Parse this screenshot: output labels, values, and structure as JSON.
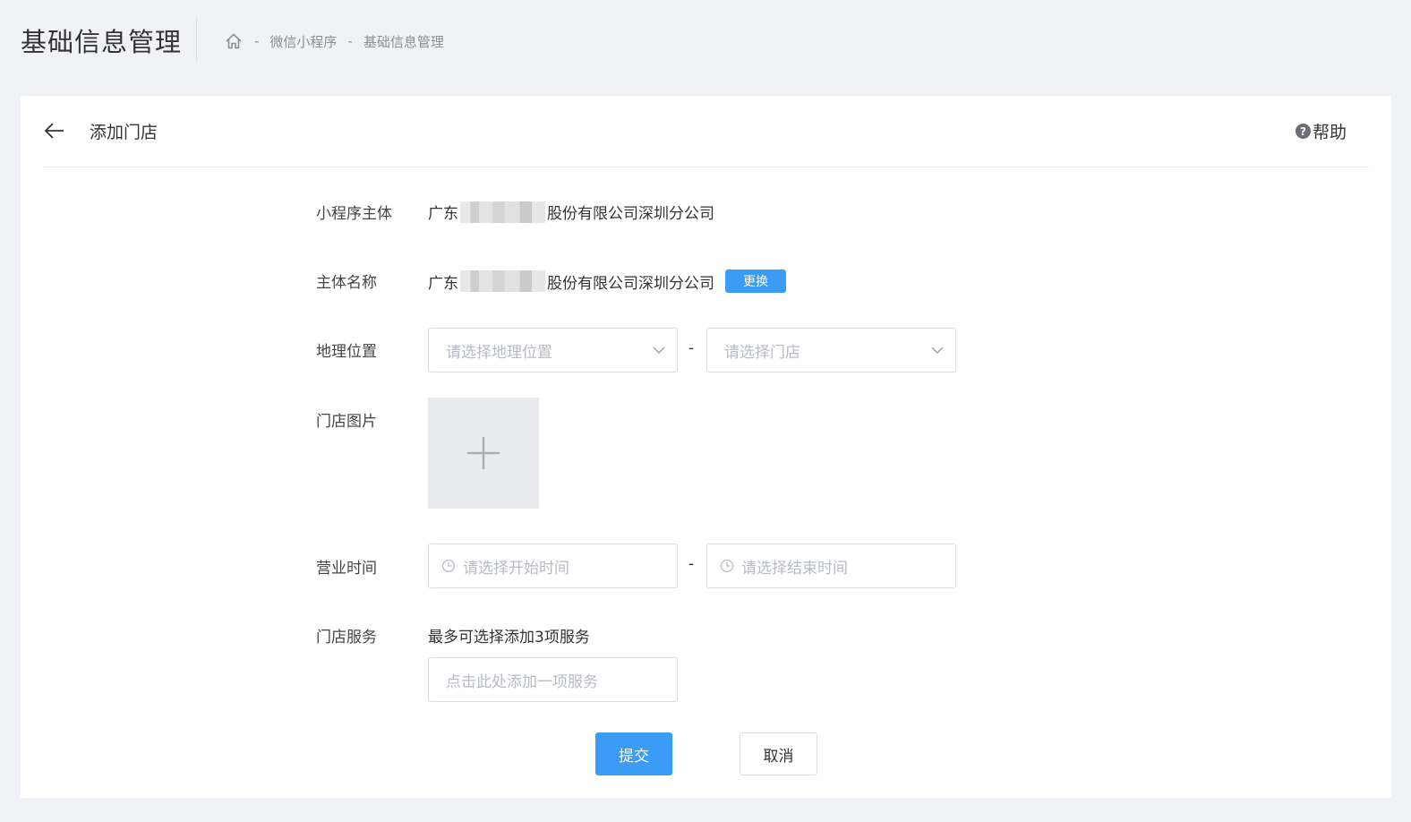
{
  "header": {
    "title": "基础信息管理",
    "breadcrumb": [
      "微信小程序",
      "基础信息管理"
    ],
    "separator": "-"
  },
  "card": {
    "title": "添加门店",
    "help_label": "帮助",
    "help_glyph": "?"
  },
  "form": {
    "subject": {
      "label": "小程序主体",
      "value_prefix": "广东",
      "value_suffix": "股份有限公司深圳分公司"
    },
    "entity_name": {
      "label": "主体名称",
      "value_prefix": "广东",
      "value_suffix": "股份有限公司深圳分公司",
      "change_button": "更换"
    },
    "location": {
      "label": "地理位置",
      "region_placeholder": "请选择地理位置",
      "store_placeholder": "请选择门店",
      "separator": "-"
    },
    "photo": {
      "label": "门店图片"
    },
    "hours": {
      "label": "营业时间",
      "start_placeholder": "请选择开始时间",
      "end_placeholder": "请选择结束时间",
      "separator": "-"
    },
    "services": {
      "label": "门店服务",
      "hint": "最多可选择添加3项服务",
      "placeholder": "点击此处添加一项服务"
    }
  },
  "actions": {
    "submit": "提交",
    "cancel": "取消"
  },
  "colors": {
    "primary": "#3a9cf5",
    "background": "#f0f2f7",
    "border": "#d9dce2"
  },
  "icons": [
    "home-icon",
    "back-arrow-icon",
    "help-icon",
    "chevron-down-icon",
    "clock-icon",
    "plus-icon"
  ]
}
